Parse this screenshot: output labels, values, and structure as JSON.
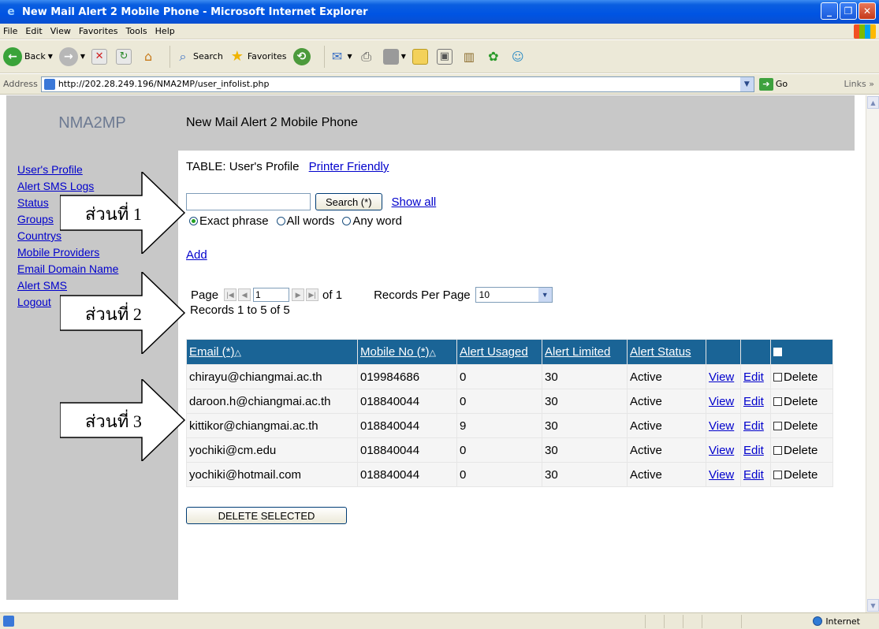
{
  "window": {
    "title": "New Mail Alert 2 Mobile Phone - Microsoft Internet Explorer"
  },
  "menu": [
    "File",
    "Edit",
    "View",
    "Favorites",
    "Tools",
    "Help"
  ],
  "toolbar": {
    "back_label": "Back",
    "search_label": "Search",
    "favorites_label": "Favorites"
  },
  "address": {
    "label": "Address",
    "url": "http://202.28.249.196/NMA2MP/user_infolist.php",
    "go_label": "Go",
    "links_label": "Links"
  },
  "sidebar": {
    "brand": "NMA2MP",
    "items": [
      {
        "label": "User's Profile"
      },
      {
        "label": "Alert SMS Logs"
      },
      {
        "label": "Status"
      },
      {
        "label": "Groups"
      },
      {
        "label": "Countrys"
      },
      {
        "label": "Mobile Providers"
      },
      {
        "label": "Email Domain Name"
      },
      {
        "label": "Alert SMS"
      },
      {
        "label": "Logout"
      }
    ]
  },
  "header": {
    "title": "New Mail Alert 2 Mobile Phone"
  },
  "main": {
    "table_title": "TABLE: User's Profile",
    "printer_friendly": "Printer Friendly",
    "search": {
      "value": "",
      "button_label": "Search (*)",
      "show_all": "Show all",
      "options": [
        "Exact phrase",
        "All words",
        "Any word"
      ],
      "selected": "Exact phrase"
    },
    "add_label": "Add",
    "pager": {
      "page_label": "Page",
      "current_page": "1",
      "of_label": "of 1",
      "records_per_page_label": "Records Per Page",
      "records_per_page_value": "10",
      "records_info": "Records 1 to 5 of 5"
    },
    "table": {
      "columns": [
        "Email (*)",
        "Mobile No (*)",
        "Alert Usaged",
        "Alert Limited",
        "Alert Status"
      ],
      "sort_marker": "△",
      "rows": [
        {
          "email": "chirayu@chiangmai.ac.th",
          "mobile": "019984686",
          "usaged": "0",
          "limited": "30",
          "status": "Active"
        },
        {
          "email": "daroon.h@chiangmai.ac.th",
          "mobile": "018840044",
          "usaged": "0",
          "limited": "30",
          "status": "Active"
        },
        {
          "email": "kittikor@chiangmai.ac.th",
          "mobile": "018840044",
          "usaged": "9",
          "limited": "30",
          "status": "Active"
        },
        {
          "email": "yochiki@cm.edu",
          "mobile": "018840044",
          "usaged": "0",
          "limited": "30",
          "status": "Active"
        },
        {
          "email": "yochiki@hotmail.com",
          "mobile": "018840044",
          "usaged": "0",
          "limited": "30",
          "status": "Active"
        }
      ],
      "view_label": "View",
      "edit_label": "Edit",
      "delete_label": "Delete"
    },
    "delete_selected_label": "DELETE SELECTED"
  },
  "annotations": [
    "ส่วนที่ 1",
    "ส่วนที่ 2",
    "ส่วนที่ 3"
  ],
  "statusbar": {
    "zone": "Internet"
  },
  "colors": {
    "table_header": "#1a6496",
    "sidebar_bg": "#c8c8c8",
    "link": "#0000cc"
  }
}
